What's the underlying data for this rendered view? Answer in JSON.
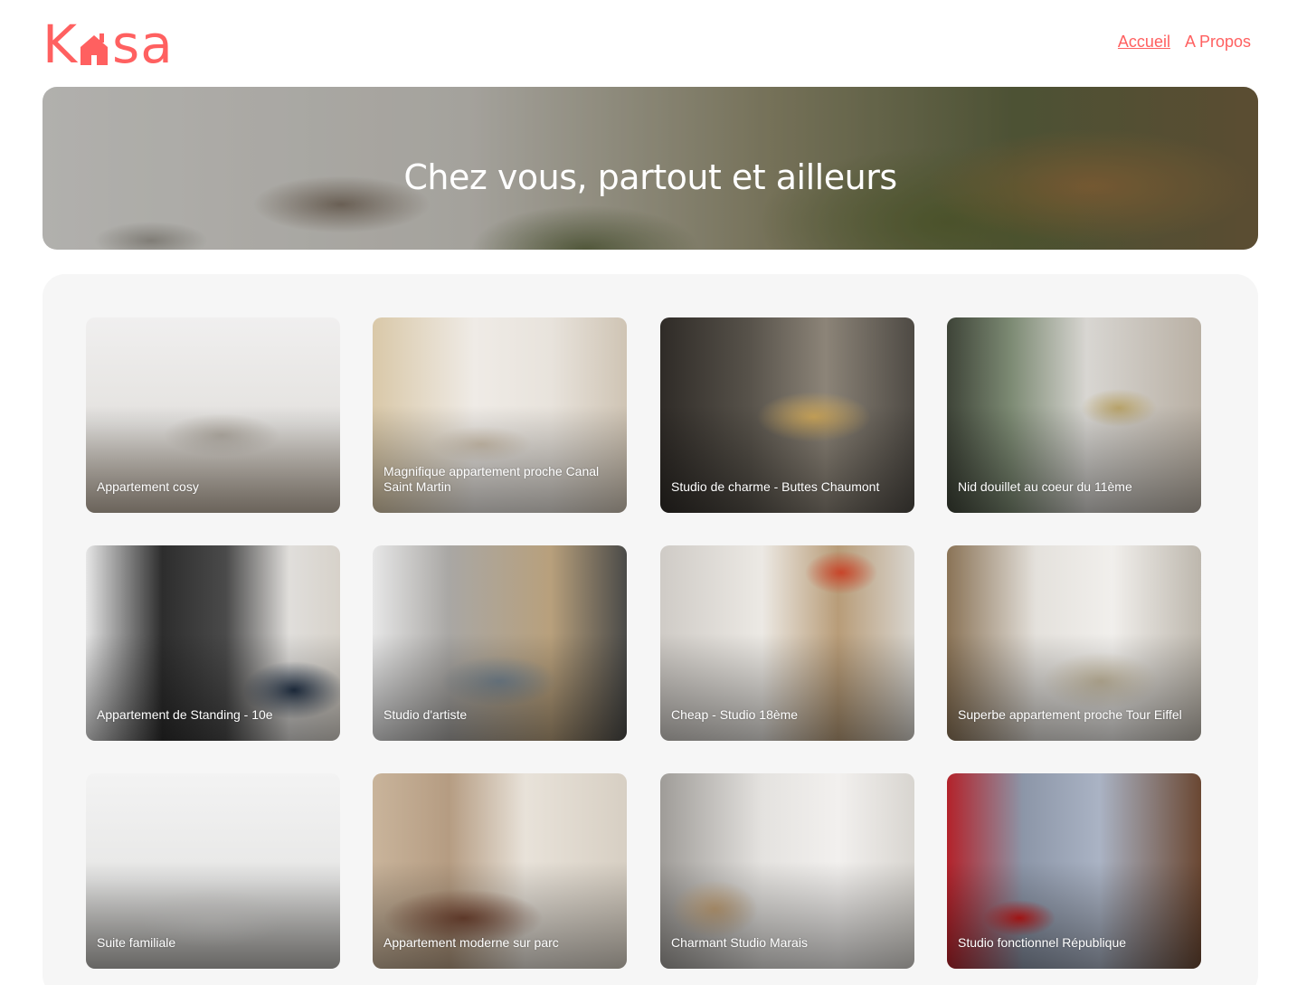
{
  "header": {
    "logo": {
      "part1": "K",
      "part2": "sa",
      "icon": "house-icon"
    },
    "nav": [
      {
        "label": "Accueil",
        "active": true
      },
      {
        "label": "A Propos",
        "active": false
      }
    ]
  },
  "banner": {
    "title": "Chez vous, partout et ailleurs"
  },
  "listings": [
    {
      "title": "Appartement cosy"
    },
    {
      "title": "Magnifique appartement proche Canal Saint Martin"
    },
    {
      "title": "Studio de charme - Buttes Chaumont"
    },
    {
      "title": "Nid douillet au coeur du 11ème"
    },
    {
      "title": "Appartement de Standing - 10e"
    },
    {
      "title": "Studio d'artiste"
    },
    {
      "title": "Cheap - Studio 18ème"
    },
    {
      "title": "Superbe appartement proche Tour Eiffel"
    },
    {
      "title": "Suite familiale"
    },
    {
      "title": "Appartement moderne sur parc"
    },
    {
      "title": "Charmant Studio Marais"
    },
    {
      "title": "Studio fonctionnel République"
    }
  ],
  "colors": {
    "brand": "#ff6060",
    "gallery_bg": "#f6f6f6"
  }
}
